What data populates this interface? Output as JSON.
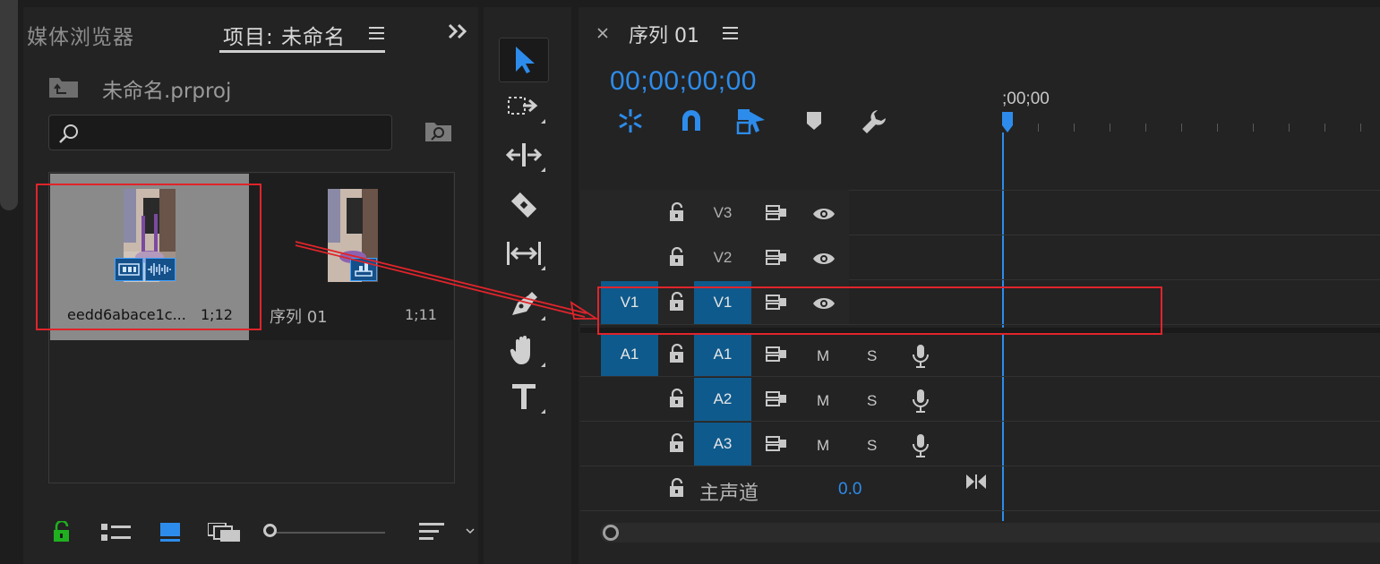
{
  "project_panel": {
    "tab_media_browser": "媒体浏览器",
    "tab_project": "项目: 未命名",
    "project_file": "未命名.prproj",
    "search_placeholder": "",
    "items": [
      {
        "name": "eedd6abace1c...",
        "duration": "1;12"
      },
      {
        "name": "序列 01",
        "duration": "1;11"
      }
    ]
  },
  "sequence_panel": {
    "tab_title": "序列 01",
    "timecode": "00;00;00;00",
    "ruler_start": ";00;00",
    "video_tracks": [
      {
        "target": "",
        "label": "V3"
      },
      {
        "target": "",
        "label": "V2"
      },
      {
        "target": "V1",
        "label": "V1"
      }
    ],
    "audio_tracks": [
      {
        "target": "A1",
        "label": "A1",
        "mute": "M",
        "solo": "S"
      },
      {
        "target": "",
        "label": "A2",
        "mute": "M",
        "solo": "S"
      },
      {
        "target": "",
        "label": "A3",
        "mute": "M",
        "solo": "S"
      }
    ],
    "master": {
      "label": "主声道",
      "value": "0.0"
    }
  },
  "colors": {
    "accent": "#2d8ceb",
    "highlight_box": "#e0242b",
    "track_target": "#0f5a8c",
    "lock_green": "#1fb01f"
  }
}
